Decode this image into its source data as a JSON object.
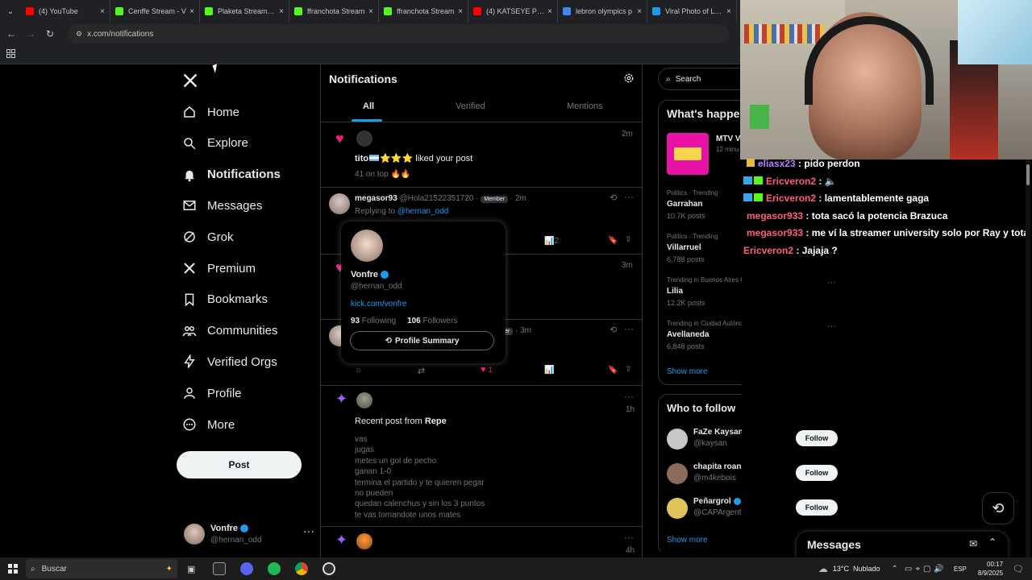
{
  "browser": {
    "tabs": [
      {
        "title": "(4) YouTube",
        "color": "#ff0000"
      },
      {
        "title": "Cenffe Stream - V",
        "color": "#53fc18"
      },
      {
        "title": "Plaketa Stream - V",
        "color": "#53fc18"
      },
      {
        "title": "ffranchota Stream",
        "color": "#53fc18"
      },
      {
        "title": "ffranchota Stream",
        "color": "#53fc18"
      },
      {
        "title": "(4) KATSEYE Perfo",
        "color": "#ff0000"
      },
      {
        "title": "lebron olympics p",
        "color": "#4285f4"
      },
      {
        "title": "Viral Photo of LeB",
        "color": "#1d9bf0"
      }
    ],
    "url": "x.com/notifications"
  },
  "nav": {
    "items": [
      {
        "label": "Home",
        "icon": "home-icon"
      },
      {
        "label": "Explore",
        "icon": "search-icon"
      },
      {
        "label": "Notifications",
        "icon": "bell-icon"
      },
      {
        "label": "Messages",
        "icon": "envelope-icon"
      },
      {
        "label": "Grok",
        "icon": "grok-icon"
      },
      {
        "label": "Premium",
        "icon": "x-logo-icon"
      },
      {
        "label": "Bookmarks",
        "icon": "bookmark-icon"
      },
      {
        "label": "Communities",
        "icon": "people-icon"
      },
      {
        "label": "Verified Orgs",
        "icon": "lightning-icon"
      },
      {
        "label": "Profile",
        "icon": "person-icon"
      },
      {
        "label": "More",
        "icon": "more-circle-icon"
      }
    ],
    "post_label": "Post",
    "account": {
      "name": "Vonfre",
      "handle": "@hernan_odd"
    }
  },
  "notifications": {
    "title": "Notifications",
    "tabs": [
      "All",
      "Verified",
      "Mentions"
    ],
    "n1": {
      "user": "tito",
      "flags": "⭐⭐⭐",
      "action": " liked your post",
      "time": "2m",
      "preview": "41 on top 🔥🔥"
    },
    "n2": {
      "name": "megasor93",
      "handle": "@Hola21522351720",
      "badge": "Member",
      "time": "2m",
      "replying_prefix": "Replying to ",
      "replying_to": "@hernan_odd",
      "views": "2"
    },
    "n3": {
      "time": "3m"
    },
    "n4": {
      "badge_partial": "er",
      "time": "3m",
      "likes": "1"
    },
    "n5": {
      "time": "1h",
      "recent_prefix": "Recent post from ",
      "recent_user": "Repe",
      "lines": [
        "vas",
        "jugas",
        "metes un gol de pecho",
        "ganan 1-0",
        "termina el partido y te quieren pegar",
        "no pueden",
        "quedan calenchus y sin los 3 puntos",
        "te vas tomandote unos mates"
      ]
    },
    "n6": {
      "time": "4h"
    }
  },
  "hovercard": {
    "name": "Vonfre",
    "handle": "@hernan_odd",
    "link": "kick.com/vonfre",
    "following_count": "93",
    "following_label": "Following",
    "followers_count": "106",
    "followers_label": "Followers",
    "summary_label": "Profile Summary"
  },
  "right": {
    "search_placeholder": "Search",
    "happening_title": "What's happe",
    "event": {
      "title": "MTV V",
      "sub": "12 minu"
    },
    "trends": [
      {
        "context": "Politics · Trending",
        "name": "Garrahan",
        "posts": "10.7K posts"
      },
      {
        "context": "Politics · Trending",
        "name": "Villarruel",
        "posts": "6,788 posts"
      },
      {
        "context": "Trending in Buenos Aires City Region",
        "name": "Lilia",
        "posts": "12.2K posts"
      },
      {
        "context": "Trending in Ciudad Autónoma de Buenos Aires",
        "name": "Avellaneda",
        "posts": "6,848 posts"
      }
    ],
    "show_more": "Show more",
    "who_to_follow_title": "Who to follow",
    "follow_suggestions": [
      {
        "name": "FaZe Kaysan",
        "handle": "@kaysan",
        "verified": true
      },
      {
        "name": "chapita roan",
        "handle": "@m4kebois",
        "verified": false
      },
      {
        "name": "Peñargrol",
        "handle": "@CAPArgento__",
        "verified": true
      }
    ],
    "follow_label": "Follow",
    "show_more_2": "Show more"
  },
  "messages_drawer": {
    "title": "Messages"
  },
  "chat": [
    {
      "user": "eliasx23",
      "text": "pido perdon",
      "color": "#b57cff"
    },
    {
      "user": "Ericveron2",
      "text": "🔈",
      "color": "#ff5e7a"
    },
    {
      "user": "Ericveron2",
      "text": "lamentablemente gaga",
      "color": "#ff5e7a"
    },
    {
      "user": "megasor933",
      "text": "tota sacó la potencia Brazuca",
      "color": "#ff5e7a"
    },
    {
      "user": "megasor933",
      "text": "me ví la streamer university solo por Ray y tota",
      "color": "#ff5e7a"
    },
    {
      "user": "Ericveron2",
      "text": "Jajaja ?",
      "color": "#ff5e7a"
    }
  ],
  "taskbar": {
    "search_placeholder": "Buscar",
    "weather": "13°C  Nublado",
    "lang": "ESP",
    "time": "00:17",
    "date": "8/9/2025"
  }
}
